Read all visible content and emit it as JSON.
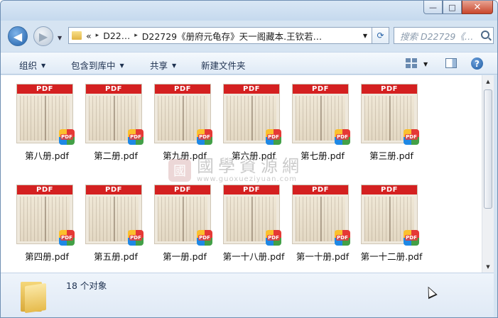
{
  "window": {
    "controls": {
      "minimize": "—",
      "maximize": "□",
      "close": "✕"
    }
  },
  "nav": {
    "back_icon": "◀",
    "forward_icon": "▶",
    "address": {
      "prefix": "«",
      "segments": [
        "D22…",
        "D22729《册府元龟存》天一阁藏本.王钦若…"
      ],
      "separator": "▸"
    },
    "search_placeholder": "搜索 D22729《…"
  },
  "toolbar": {
    "organize": "组织",
    "include_library": "包含到库中",
    "share": "共享",
    "new_folder": "新建文件夹"
  },
  "files": [
    {
      "name": "第八册.pdf"
    },
    {
      "name": "第二册.pdf"
    },
    {
      "name": "第九册.pdf"
    },
    {
      "name": "第六册.pdf"
    },
    {
      "name": "第七册.pdf"
    },
    {
      "name": "第三册.pdf"
    },
    {
      "name": "第四册.pdf"
    },
    {
      "name": "第五册.pdf"
    },
    {
      "name": "第一册.pdf"
    },
    {
      "name": "第一十八册.pdf"
    },
    {
      "name": "第一十册.pdf"
    },
    {
      "name": "第一十二册.pdf"
    }
  ],
  "thumb_band": "PDF",
  "badge_text": "PDF",
  "watermark": {
    "seal": "國",
    "cn": "國學資源網",
    "url": "www.guoxueziyuan.com"
  },
  "status": {
    "count": "18 个对象"
  }
}
